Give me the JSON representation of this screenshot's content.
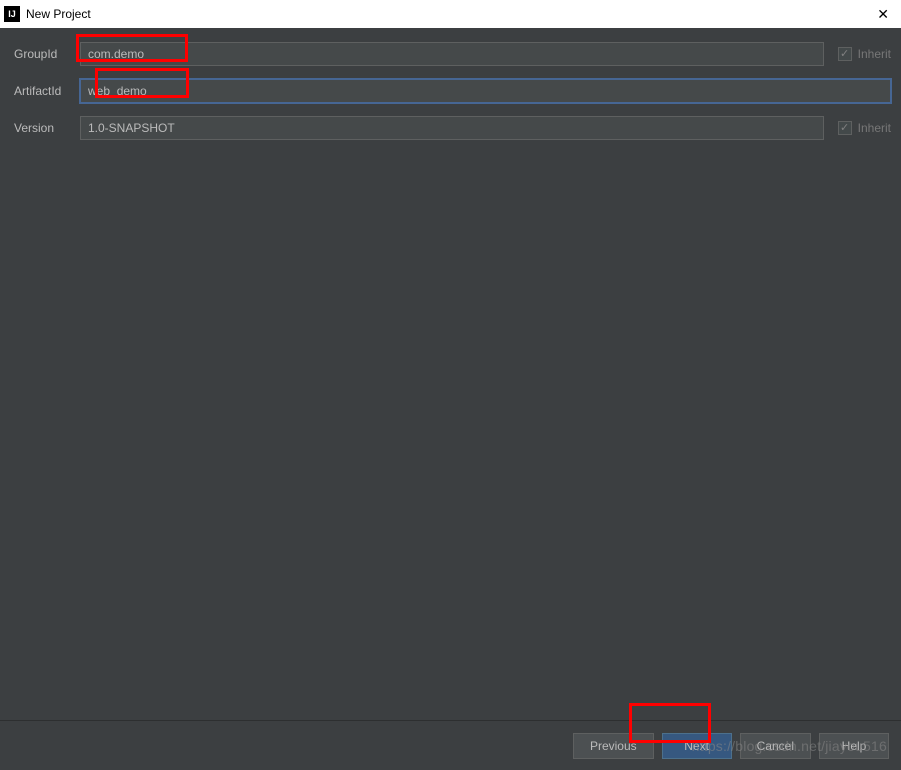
{
  "window": {
    "title": "New Project"
  },
  "form": {
    "groupId": {
      "label": "GroupId",
      "value": "com.demo",
      "inheritLabel": "Inherit"
    },
    "artifactId": {
      "label": "ArtifactId",
      "value": "web_demo"
    },
    "version": {
      "label": "Version",
      "value": "1.0-SNAPSHOT",
      "inheritLabel": "Inherit"
    }
  },
  "buttons": {
    "previous": "Previous",
    "next": "Next",
    "cancel": "Cancel",
    "help": "Help"
  },
  "watermark": "https://blog.csdn.net/jiayou516"
}
